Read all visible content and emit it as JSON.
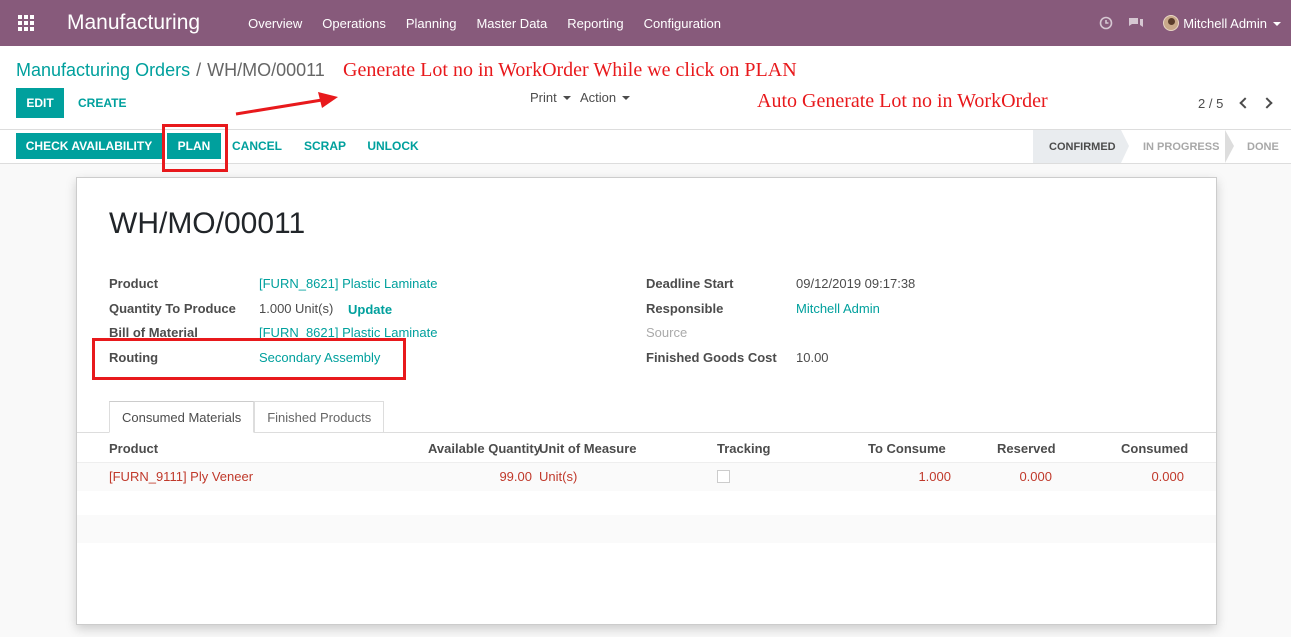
{
  "navbar": {
    "app_title": "Manufacturing",
    "menu": [
      "Overview",
      "Operations",
      "Planning",
      "Master Data",
      "Reporting",
      "Configuration"
    ],
    "user_name": "Mitchell Admin",
    "icons": [
      "apps-grid-icon",
      "clock-icon",
      "chat-icon"
    ]
  },
  "breadcrumb": {
    "parent": "Manufacturing Orders",
    "separator": "/",
    "current": "WH/MO/00011"
  },
  "buttons": {
    "edit": "EDIT",
    "create": "CREATE",
    "print": "Print",
    "action": "Action"
  },
  "pager": {
    "value": "2 / 5"
  },
  "annotations": {
    "top": "Generate Lot no in WorkOrder While we click on PLAN",
    "side": "Auto Generate Lot no in WorkOrder"
  },
  "statusbar": {
    "buttons": [
      "CHECK AVAILABILITY",
      "PLAN",
      "CANCEL",
      "SCRAP",
      "UNLOCK"
    ],
    "stages": [
      "CONFIRMED",
      "IN PROGRESS",
      "DONE"
    ],
    "active_stage": "CONFIRMED"
  },
  "form": {
    "title": "WH/MO/00011",
    "left": {
      "product_label": "Product",
      "product_value": "[FURN_8621] Plastic Laminate",
      "qty_label": "Quantity To Produce",
      "qty_value": "1.000",
      "qty_uom": "Unit(s)",
      "update": "Update",
      "bom_label": "Bill of Material",
      "bom_value": "[FURN_8621] Plastic Laminate",
      "routing_label": "Routing",
      "routing_value": "Secondary Assembly"
    },
    "right": {
      "deadline_label": "Deadline Start",
      "deadline_value": "09/12/2019 09:17:38",
      "responsible_label": "Responsible",
      "responsible_value": "Mitchell Admin",
      "source_label": "Source",
      "cost_label": "Finished Goods Cost",
      "cost_value": "10.00"
    },
    "tabs": [
      "Consumed Materials",
      "Finished Products"
    ],
    "table": {
      "columns": [
        "Product",
        "Available Quantity",
        "Unit of Measure",
        "Tracking",
        "To Consume",
        "Reserved",
        "Consumed"
      ],
      "rows": [
        {
          "product": "[FURN_9111] Ply Veneer",
          "available": "99.00",
          "uom": "Unit(s)",
          "to_consume": "1.000",
          "reserved": "0.000",
          "consumed": "0.000"
        }
      ]
    }
  },
  "colors": {
    "navbar": "#875a7b",
    "primary": "#00a09d",
    "annotation": "#e8191c",
    "warning_text": "#c0392b"
  }
}
